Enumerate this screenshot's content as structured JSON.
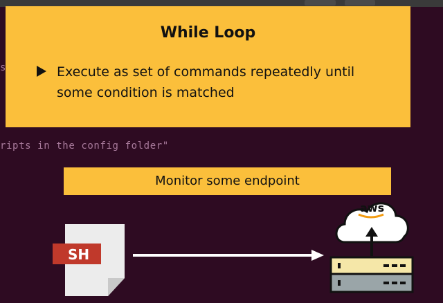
{
  "terminal": {
    "partial_line": "ripts in the config folder\"",
    "left_char": "s"
  },
  "slide": {
    "title": "While Loop",
    "bullet": "Execute as set of commands repeatedly until some condition is matched"
  },
  "banner": {
    "label": "Monitor some endpoint"
  },
  "diagram": {
    "file_label": "SH",
    "cloud_label": "aws"
  },
  "colors": {
    "background": "#2e0b22",
    "card": "#fbbf3b",
    "terminal_text": "#a87a9b",
    "sh_badge": "#c0392b"
  }
}
